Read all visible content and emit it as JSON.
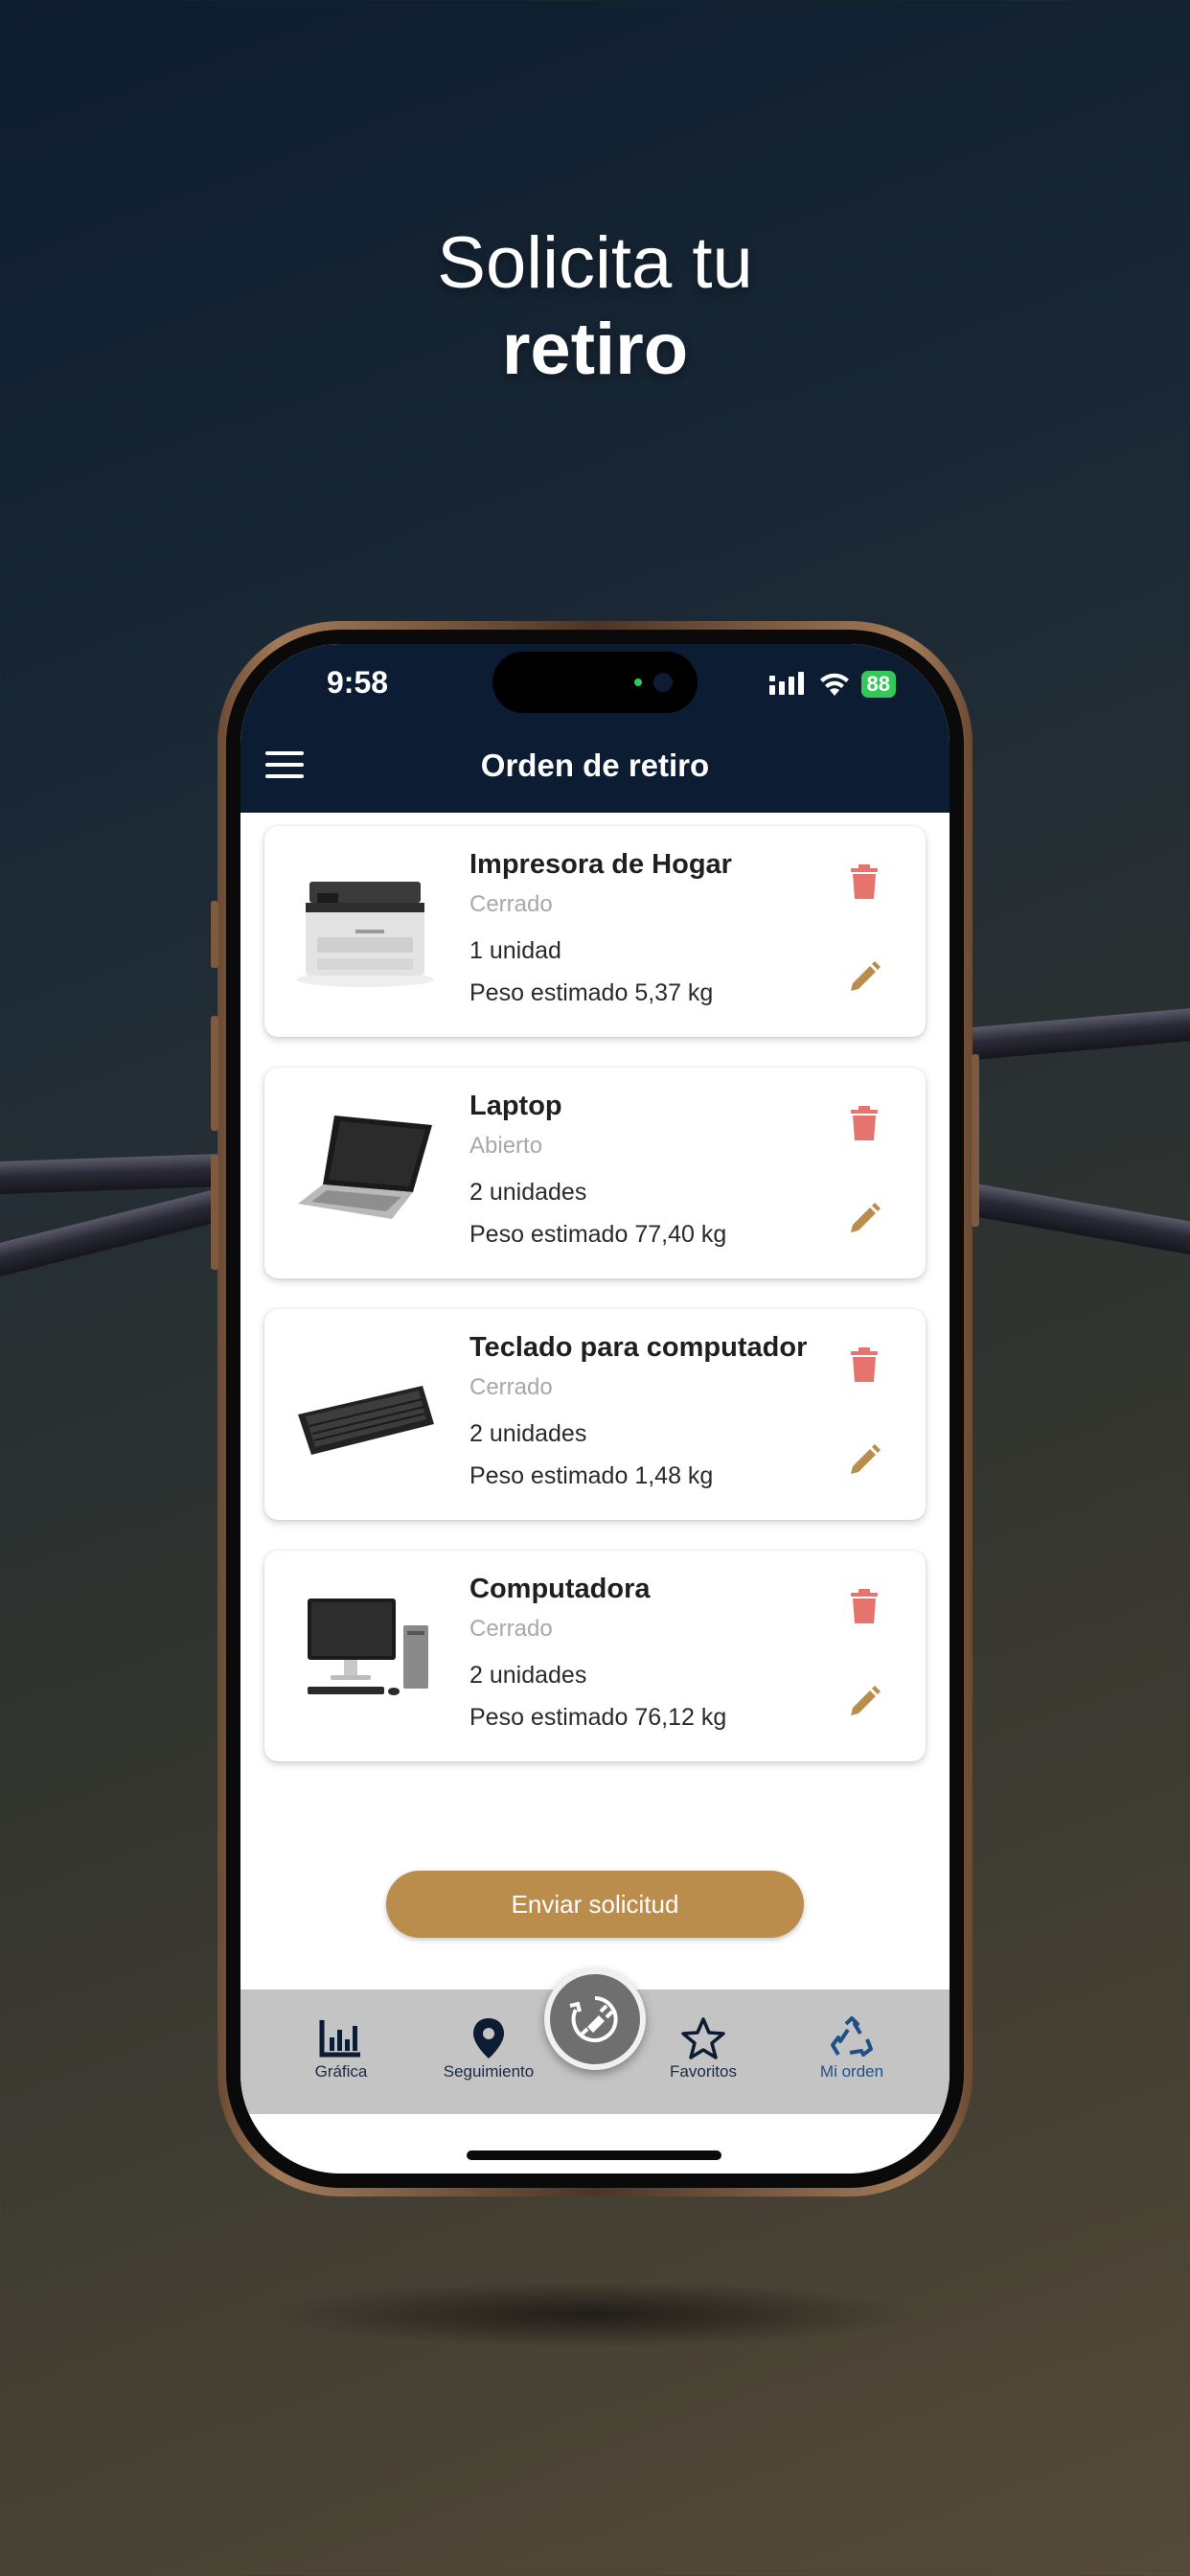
{
  "headline": {
    "line1": "Solicita tu",
    "line2": "retiro"
  },
  "status_bar": {
    "time": "9:58",
    "battery": "88"
  },
  "header": {
    "title": "Orden de retiro"
  },
  "items": [
    {
      "name": "Impresora de Hogar",
      "status": "Cerrado",
      "quantity": "1 unidad",
      "weight": "Peso estimado 5,37 kg",
      "image": "printer-icon"
    },
    {
      "name": "Laptop",
      "status": "Abierto",
      "quantity": "2 unidades",
      "weight": "Peso estimado 77,40 kg",
      "image": "laptop-icon"
    },
    {
      "name": "Teclado para computador",
      "status": "Cerrado",
      "quantity": "2 unidades",
      "weight": "Peso estimado 1,48 kg",
      "image": "keyboard-icon"
    },
    {
      "name": "Computadora",
      "status": "Cerrado",
      "quantity": "2 unidades",
      "weight": "Peso estimado 76,12 kg",
      "image": "desktop-computer-icon"
    }
  ],
  "actions": {
    "send_label": "Enviar solicitud"
  },
  "tabs": [
    {
      "label": "Gráfica",
      "icon": "bar-chart-icon"
    },
    {
      "label": "Seguimiento",
      "icon": "location-pin-icon"
    },
    {
      "label": "Favoritos",
      "icon": "star-icon"
    },
    {
      "label": "Mi orden",
      "icon": "recycle-icon",
      "active": true
    }
  ],
  "colors": {
    "header_bg": "#0c1d33",
    "accent_gold": "#bb8d4d",
    "delete_red": "#e5736e",
    "tabbar_bg": "#c4c4c4",
    "active_tab": "#1f4f86"
  }
}
